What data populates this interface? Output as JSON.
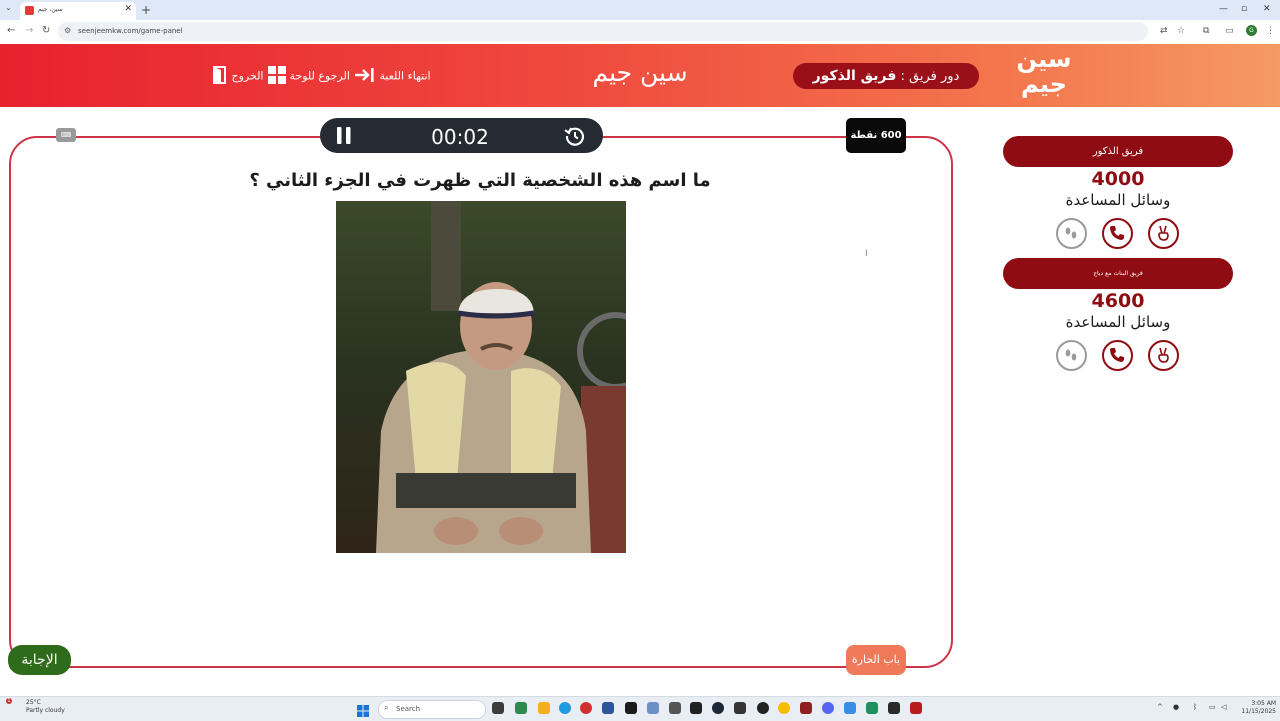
{
  "browser": {
    "tab_title": "سين، جيم",
    "url": "seenjeemkw.com/game-panel",
    "new_tab_label": "+",
    "profile_initial": "G"
  },
  "header": {
    "logo_line1": "سين",
    "logo_line2": "جيم",
    "site_title": "سين جيم",
    "turn_prefix": "دور فريق :",
    "turn_team": "فريق الذكور",
    "end_game": "انتهاء اللعبة",
    "back_to_board": "الرجوع للوحة",
    "exit": "الخروج"
  },
  "game": {
    "timer": "00:02",
    "points": "600 نقطة",
    "question": "ما اسم هذه الشخصية التي ظهرت في الجزء الثاني ؟",
    "category": "باب الحارة",
    "answer_button": "الإجابة",
    "panel_icon": "⌨"
  },
  "teams": [
    {
      "name": "فريق الذكور",
      "score": "4000",
      "helps_label": "وسائل المساعدة"
    },
    {
      "name": "فريق البنات مع دياج",
      "score": "4600",
      "helps_label": "وسائل المساعدة"
    }
  ],
  "taskbar": {
    "temperature": "25°C",
    "weather": "Partly cloudy",
    "weather_badge": "1",
    "search_placeholder": "Search",
    "time": "3:05 AM",
    "date": "11/15/2025"
  },
  "colors": {
    "header_start": "#e8212f",
    "header_end": "#f59a62",
    "team_pill": "#8f0c12",
    "timer_bg": "#252a33",
    "answer_bg": "#2e6b1b",
    "category_bg": "#f0795a"
  }
}
